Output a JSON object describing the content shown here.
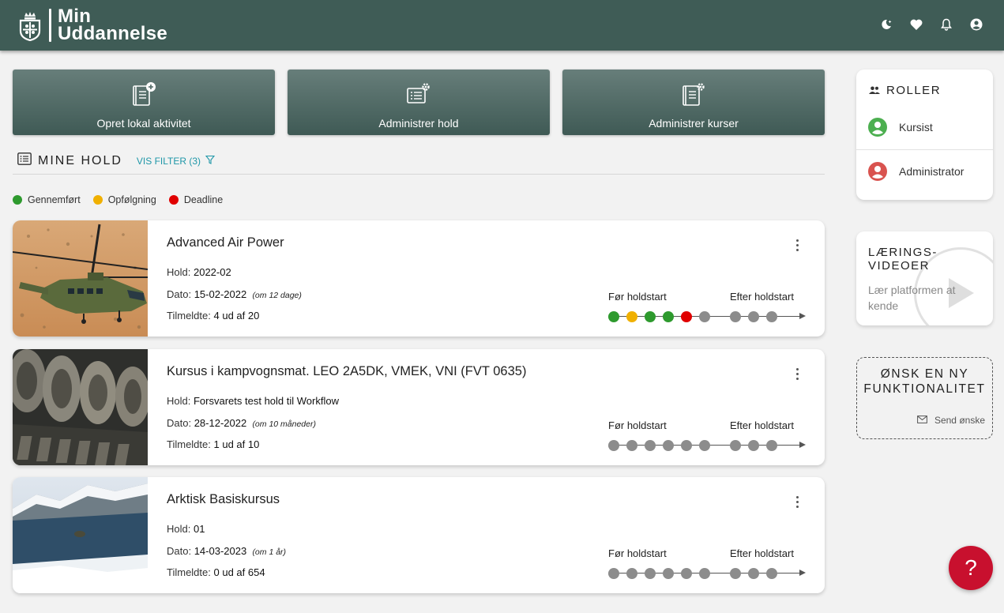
{
  "app": {
    "brand_line1": "Min",
    "brand_line2": "Uddannelse",
    "header_bg": "#3f5c56",
    "header_icons": [
      "theme-toggle-icon",
      "favorites-heart-icon",
      "notifications-bell-icon",
      "user-account-icon"
    ]
  },
  "actions": [
    {
      "label": "Opret lokal aktivitet",
      "icon": "book-plus-icon"
    },
    {
      "label": "Administrer hold",
      "icon": "list-gear-icon"
    },
    {
      "label": "Administrer kurser",
      "icon": "book-gear-icon"
    }
  ],
  "section": {
    "title": "MINE HOLD",
    "filter_label": "VIS FILTER (3)"
  },
  "legend": [
    {
      "label": "Gennemført",
      "color": "#2e9a2e"
    },
    {
      "label": "Opfølgning",
      "color": "#f0b000"
    },
    {
      "label": "Deadline",
      "color": "#e00000"
    }
  ],
  "labels": {
    "hold": "Hold:",
    "dato": "Dato:",
    "tilmeldte": "Tilmeldte:",
    "pre": "Før holdstart",
    "post": "Efter holdstart"
  },
  "courses": [
    {
      "title": "Advanced Air Power",
      "hold": "2022-02",
      "dato": "15-02-2022",
      "relative": "(om 12 dage)",
      "tilmeldte": "4 ud af  20",
      "image": "helicopter-photo",
      "steps": [
        "done",
        "followup",
        "done",
        "done",
        "deadline",
        "pending",
        "pending",
        "pending",
        "pending"
      ]
    },
    {
      "title": "Kursus i kampvognsmat. LEO 2A5DK, VMEK, VNI (FVT 0635)",
      "hold": "Forsvarets test hold til Workflow",
      "dato": "28-12-2022",
      "relative": "(om 10 måneder)",
      "tilmeldte": "1 ud af  10",
      "image": "tank-tracks-photo",
      "steps": [
        "pending",
        "pending",
        "pending",
        "pending",
        "pending",
        "pending",
        "pending",
        "pending",
        "pending"
      ]
    },
    {
      "title": "Arktisk Basiskursus",
      "hold": "01",
      "dato": "14-03-2023",
      "relative": "(om 1 år)",
      "tilmeldte": "0 ud af  654",
      "image": "arctic-fjord-photo",
      "steps": [
        "pending",
        "pending",
        "pending",
        "pending",
        "pending",
        "pending",
        "pending",
        "pending",
        "pending"
      ]
    }
  ],
  "roles": {
    "title": "ROLLER",
    "items": [
      {
        "label": "Kursist",
        "color": "#4caf50"
      },
      {
        "label": "Administrator",
        "color": "#d9534f"
      }
    ]
  },
  "videos": {
    "title_line1": "LÆRINGS-",
    "title_line2": "VIDEOER",
    "subtitle": "Lær platformen at kende"
  },
  "wish": {
    "title_line1": "ØNSK EN NY",
    "title_line2": "FUNKTIONALITET",
    "link": "Send ønske"
  },
  "help": {
    "label": "?",
    "color": "#c8102e"
  },
  "step_colors": {
    "done": "#2e9a2e",
    "followup": "#f0b000",
    "deadline": "#e00000",
    "pending": "#8c8c8c"
  }
}
